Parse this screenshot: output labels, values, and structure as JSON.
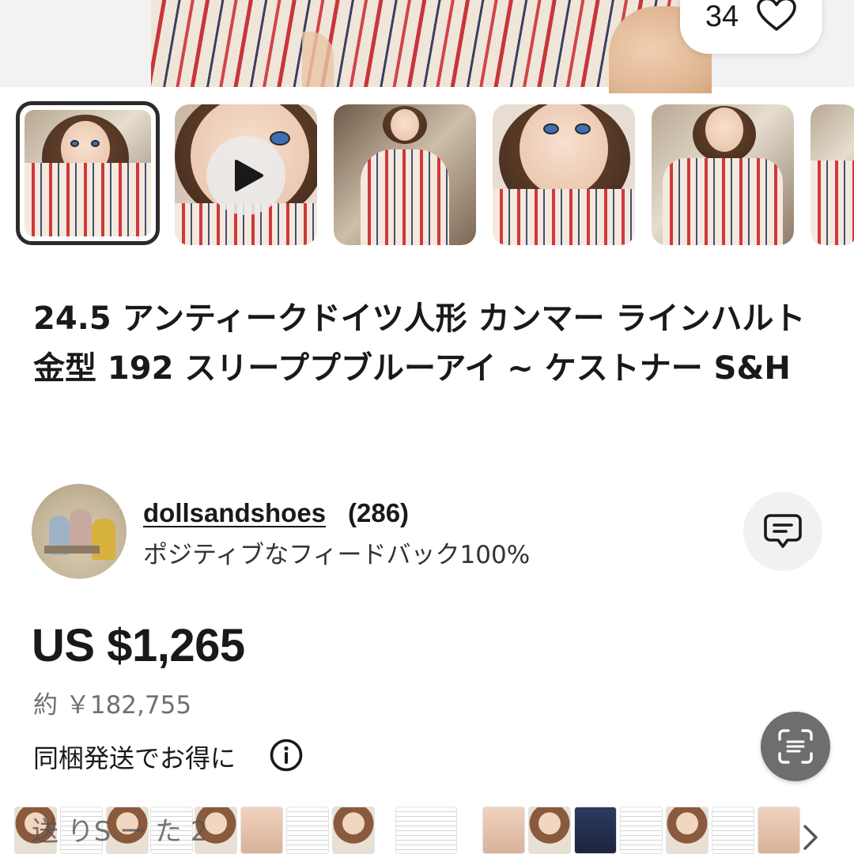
{
  "hero": {
    "like_count": "34"
  },
  "listing": {
    "title": "24.5 アンティークドイツ人形 カンマー ラインハルト金型 192 スリーププブルーアイ ~ ケストナー S&H"
  },
  "seller": {
    "name": "dollsandshoes",
    "count": "(286)",
    "feedback": "ポジティブなフィードバック100%"
  },
  "price": {
    "amount": "US $1,265",
    "approx": "約 ￥182,755",
    "bundle_text": "同梱発送でお得に"
  },
  "strip": {
    "partial_text": "送  りS      ー   た  2"
  },
  "icons": {
    "like": "heart-icon",
    "video": "play-icon",
    "message": "message-icon",
    "info": "info-icon",
    "scan": "scan-icon",
    "next": "chevron-right-icon"
  },
  "colors": {
    "text": "#191919",
    "muted": "#707070",
    "selected_border": "#2b2b2b",
    "scan_button": "#6e6e6e"
  }
}
